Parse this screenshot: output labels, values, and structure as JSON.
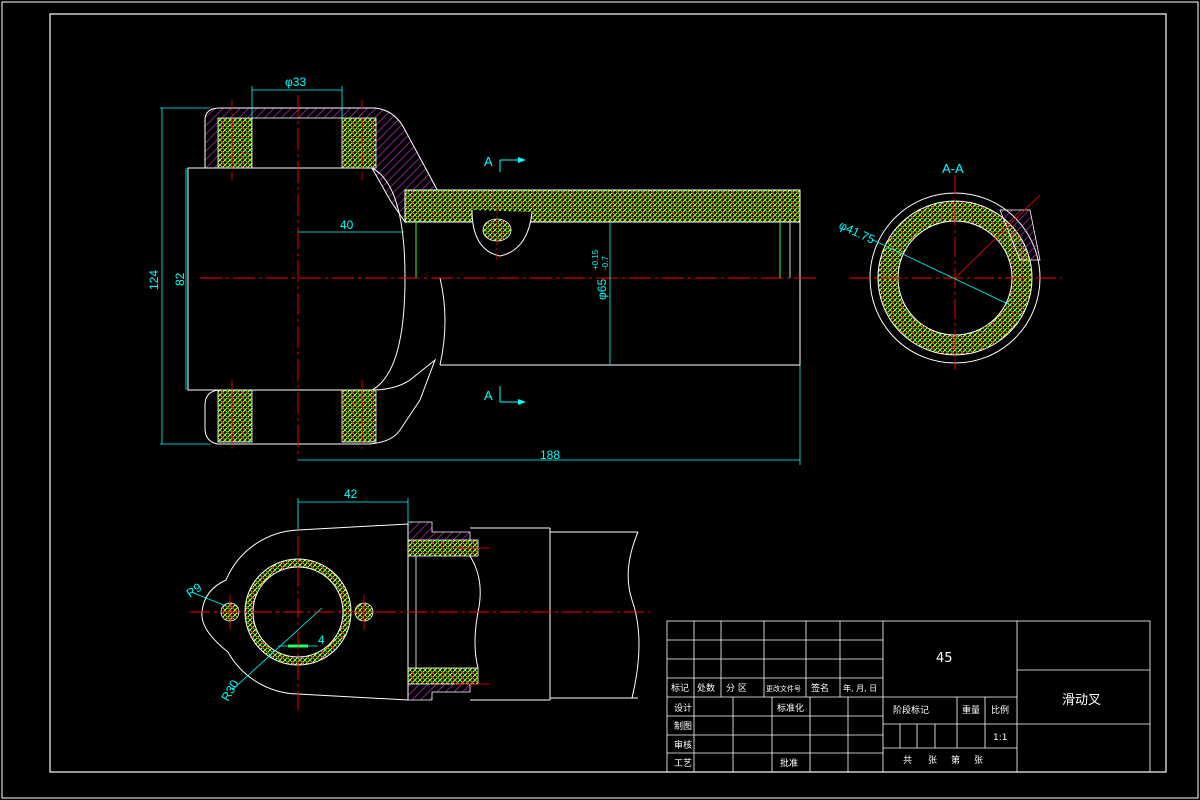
{
  "drawing": {
    "part_name": "滑动叉",
    "material": "45",
    "section_label": "A-A",
    "section_marker": "A",
    "dimensions": {
      "d33": "φ33",
      "len40": "40",
      "h124": "124",
      "h82": "82",
      "d65": "φ65",
      "d65_tol_upper": "+0.15",
      "d65_tol_lower": "-0.7",
      "len188": "188",
      "len42": "42",
      "r9": "R9",
      "r30": "R30",
      "len4": "4",
      "d41": "φ41.75"
    }
  },
  "title_block": {
    "header_row": [
      "标记",
      "处数",
      "分 区",
      "更改文件号",
      "签名",
      "年, 月, 日"
    ],
    "design": "设计",
    "standardize": "标准化",
    "drawing": "制图",
    "review": "审核",
    "process": "工艺",
    "approve": "批准",
    "stage_mark": "阶段标记",
    "weight": "重量",
    "scale_label": "比例",
    "scale_value": "1:1",
    "sheets_total": "共",
    "sheets_unit": "张",
    "sheet_no": "第",
    "sheet_unit2": "张"
  },
  "colors": {
    "outline": "#ffffff",
    "center_line": "#ff0000",
    "dimension": "#00ffff",
    "hatch_green": "#33ff33",
    "hatch_yellow": "#ffff00",
    "hatch_magenta": "#cc33cc",
    "frame": "#ffffff"
  }
}
